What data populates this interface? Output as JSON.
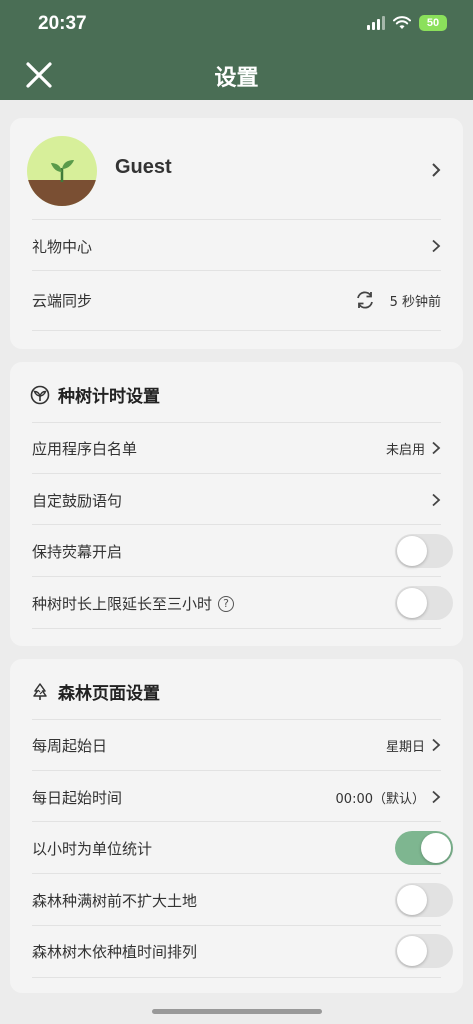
{
  "status_bar": {
    "time": "20:37",
    "battery": "50"
  },
  "header": {
    "title": "设置"
  },
  "account": {
    "name": "Guest",
    "rows": [
      {
        "label": "礼物中心"
      },
      {
        "label": "云端同步",
        "value": "5 秒钟前"
      }
    ]
  },
  "timer_section": {
    "title": "种树计时设置",
    "rows": [
      {
        "label": "应用程序白名单",
        "value": "未启用"
      },
      {
        "label": "自定鼓励语句"
      },
      {
        "label": "保持荧幕开启",
        "toggle": false
      },
      {
        "label": "种树时长上限延长至三小时",
        "help": "?",
        "toggle": false
      }
    ]
  },
  "forest_section": {
    "title": "森林页面设置",
    "rows": [
      {
        "label": "每周起始日",
        "value": "星期日"
      },
      {
        "label": "每日起始时间",
        "value": "00:00（默认）"
      },
      {
        "label": "以小时为单位统计",
        "toggle": true
      },
      {
        "label": "森林种满树前不扩大土地",
        "toggle": false
      },
      {
        "label": "森林树木依种植时间排列",
        "toggle": false
      }
    ]
  },
  "colors": {
    "header": "#4a6e55",
    "toggle_on": "#7eb690",
    "battery": "#8be05b"
  },
  "icons": [
    "close-icon",
    "chevron-right-icon",
    "sync-icon",
    "seedling-icon",
    "forest-icon",
    "help-icon"
  ]
}
